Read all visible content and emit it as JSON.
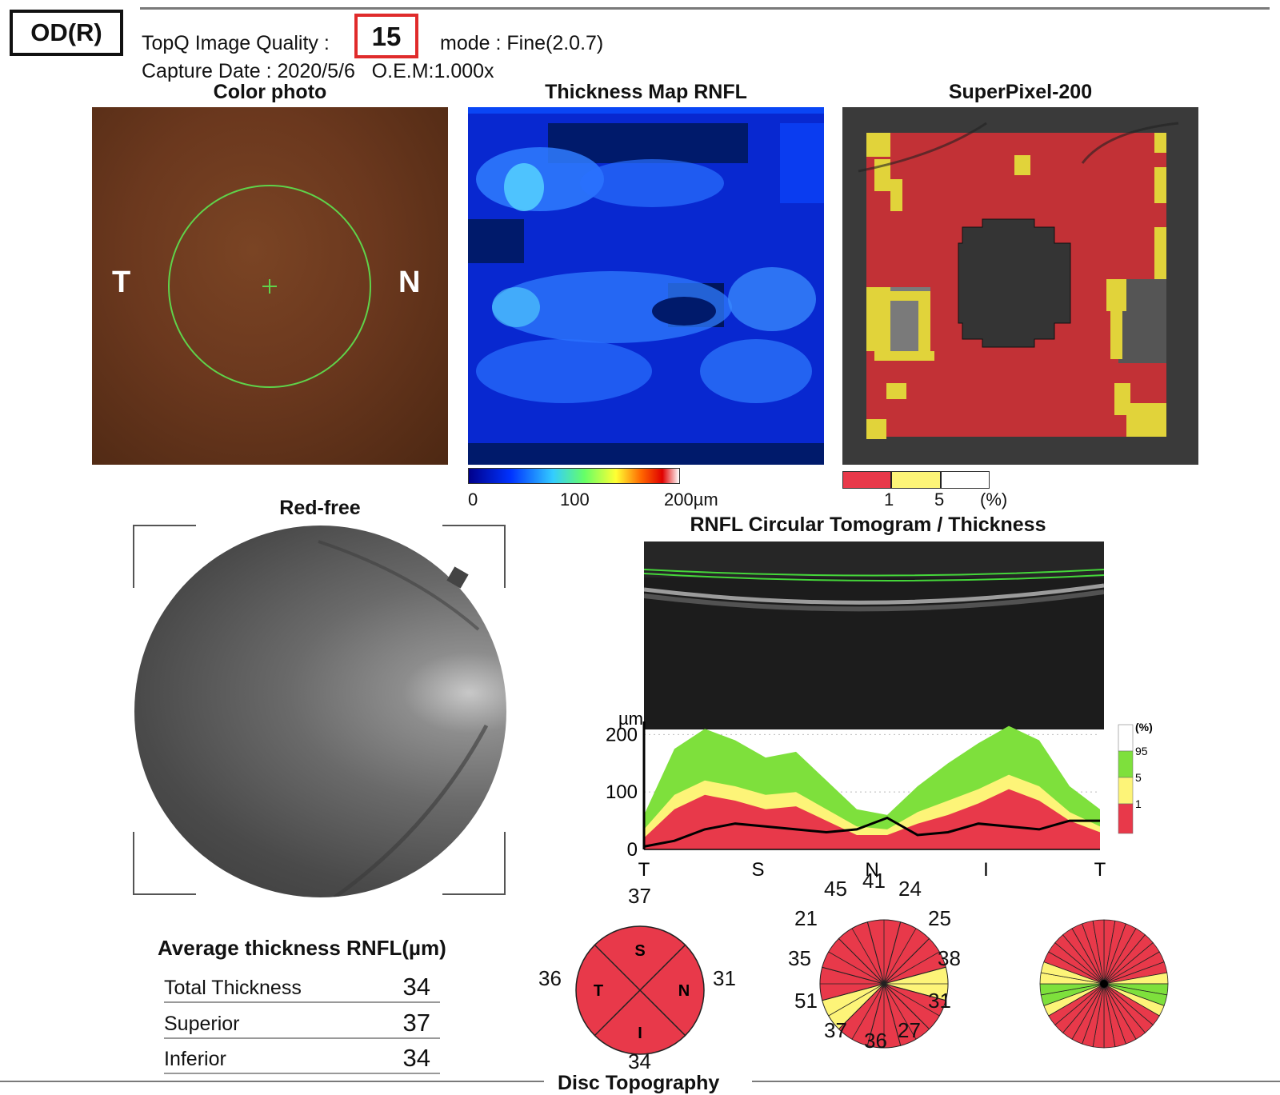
{
  "header": {
    "eye": "OD(R)",
    "quality_label": "TopQ Image Quality :",
    "quality_value": "15",
    "mode": "mode : Fine(2.0.7)",
    "capture": "Capture Date : 2020/5/6   O.E.M:1.000x"
  },
  "color_photo": {
    "title": "Color photo",
    "left_label": "T",
    "right_label": "N"
  },
  "thickness_map": {
    "title": "Thickness Map RNFL",
    "scale_ticks": [
      "0",
      "100",
      "200µm"
    ]
  },
  "superpixel": {
    "title": "SuperPixel-200",
    "scale_ticks": [
      "1",
      "5",
      "(%)"
    ]
  },
  "red_free": {
    "title": "Red-free"
  },
  "tomogram": {
    "title": "RNFL Circular Tomogram / Thickness"
  },
  "chart_data": {
    "type": "area",
    "ylabel": "µm",
    "ylim": [
      0,
      220
    ],
    "yticks": [
      "200",
      "100",
      "0"
    ],
    "x_labels": [
      "T",
      "S",
      "N",
      "I",
      "T"
    ],
    "legend": {
      "title": "(%)",
      "entries": [
        "95",
        "5",
        "1"
      ]
    },
    "series": [
      {
        "name": "95",
        "values": [
          60,
          175,
          210,
          190,
          160,
          170,
          120,
          70,
          60,
          110,
          150,
          185,
          215,
          190,
          110,
          70
        ]
      },
      {
        "name": "5",
        "values": [
          35,
          95,
          120,
          110,
          95,
          100,
          70,
          40,
          35,
          65,
          85,
          105,
          130,
          110,
          65,
          40
        ]
      },
      {
        "name": "1",
        "values": [
          20,
          70,
          95,
          85,
          70,
          75,
          50,
          25,
          25,
          45,
          60,
          80,
          105,
          85,
          50,
          30
        ]
      },
      {
        "name": "measured",
        "values": [
          5,
          15,
          35,
          45,
          40,
          35,
          30,
          35,
          55,
          25,
          30,
          45,
          40,
          35,
          50,
          50
        ]
      }
    ],
    "colors": {
      "above95": "#ffffff",
      "normal": "#7ee03c",
      "borderline": "#fdf478",
      "outside": "#e8394a",
      "line": "#000000"
    }
  },
  "average": {
    "title": "Average thickness RNFL(µm)",
    "rows": [
      {
        "label": "Total Thickness",
        "value": "34"
      },
      {
        "label": "Superior",
        "value": "37"
      },
      {
        "label": "Inferior",
        "value": "34"
      }
    ]
  },
  "quadrant": {
    "labels": {
      "S": "S",
      "T": "T",
      "N": "N",
      "I": "I"
    },
    "values": {
      "top": "37",
      "left": "36",
      "right": "31",
      "bottom": "34"
    }
  },
  "clock": {
    "values": [
      "41",
      "24",
      "25",
      "38",
      "31",
      "27",
      "36",
      "37",
      "51",
      "35",
      "21",
      "45"
    ]
  },
  "footer": {
    "label": "Disc Topography"
  }
}
